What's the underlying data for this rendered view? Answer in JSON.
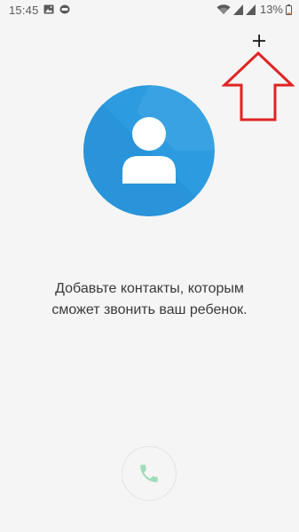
{
  "status_bar": {
    "time": "15:45",
    "battery": "13%"
  },
  "toolbar": {
    "add_label": "+"
  },
  "empty_state": {
    "line1": "Добавьте контакты, которым",
    "line2": "сможет звонить ваш ребенок."
  },
  "colors": {
    "avatar_blue": "#2d9be0",
    "annotation_red": "#e02424",
    "call_green": "#9fdcb8"
  },
  "icons": {
    "add": "plus-icon",
    "avatar": "person-icon",
    "call": "phone-icon",
    "annotation": "arrow-up-icon"
  }
}
